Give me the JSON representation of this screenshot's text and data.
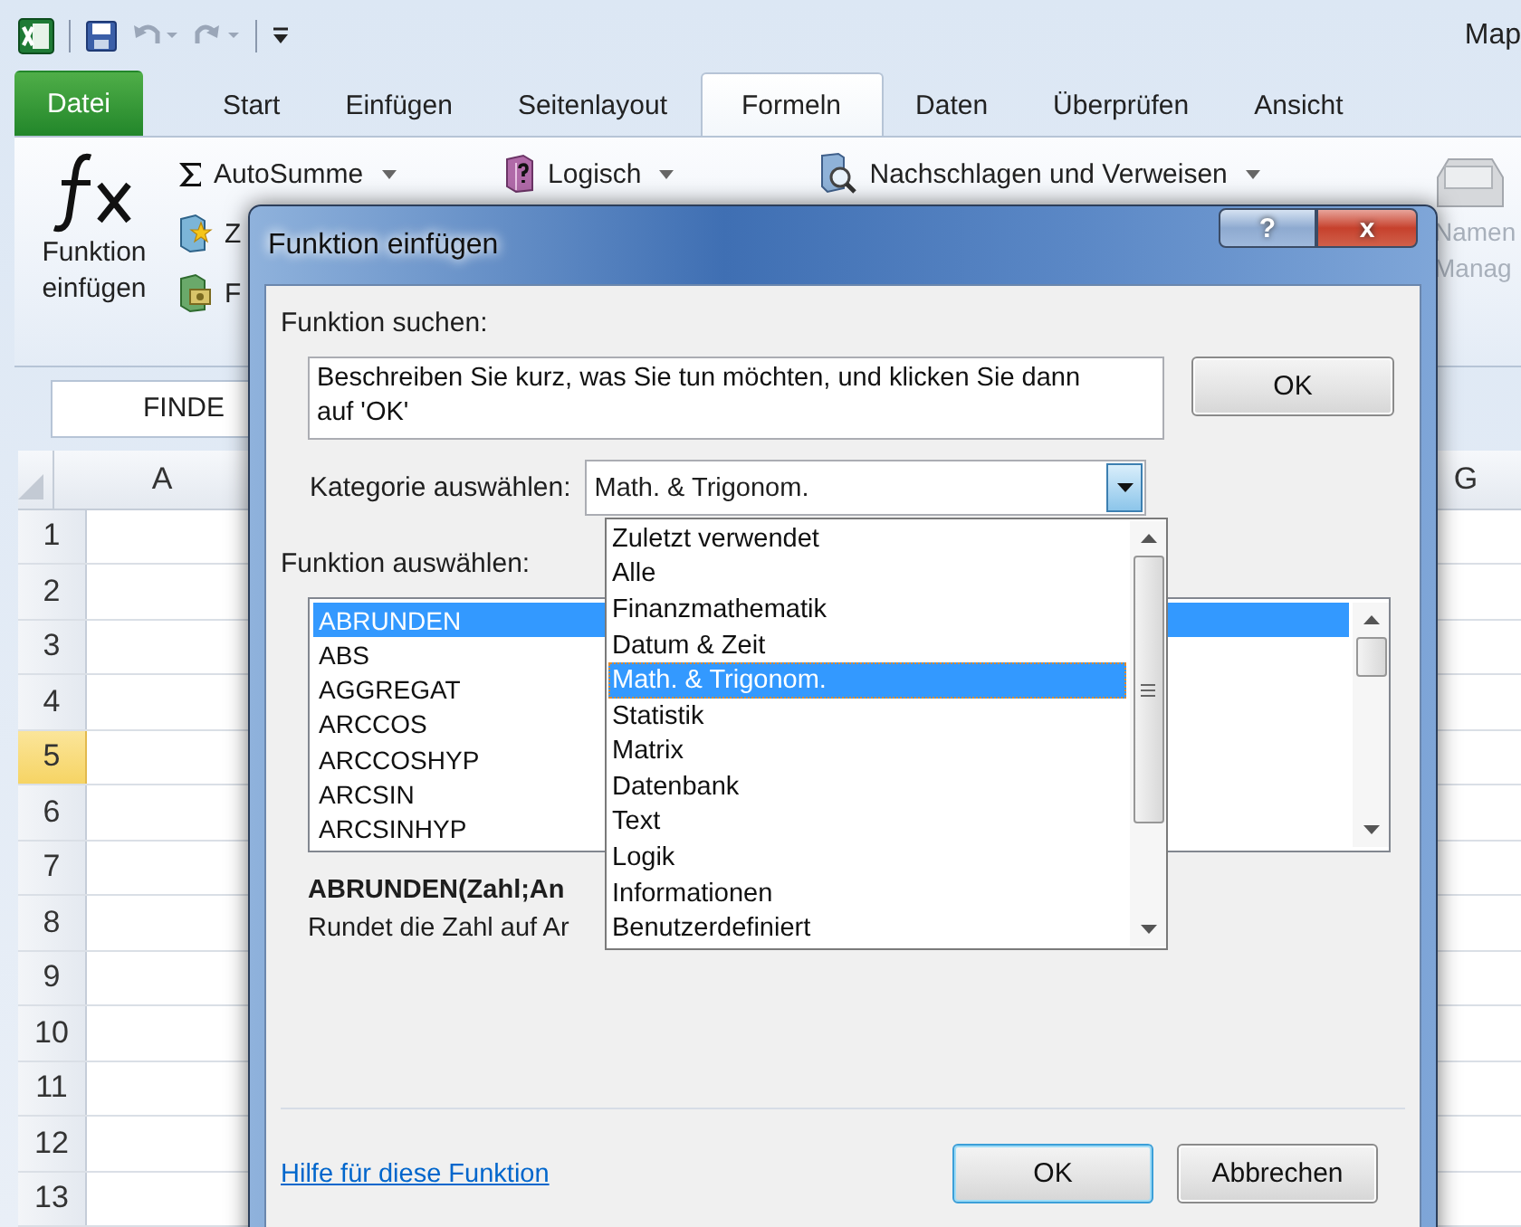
{
  "title_bar": {
    "title": "Map"
  },
  "ribbon_tabs": [
    {
      "label": "Datei",
      "kind": "file",
      "selected": false
    },
    {
      "label": "Start",
      "kind": "tab",
      "selected": false
    },
    {
      "label": "Einfügen",
      "kind": "tab",
      "selected": false
    },
    {
      "label": "Seitenlayout",
      "kind": "tab",
      "selected": false
    },
    {
      "label": "Formeln",
      "kind": "tab",
      "selected": true
    },
    {
      "label": "Daten",
      "kind": "tab",
      "selected": false
    },
    {
      "label": "Überprüfen",
      "kind": "tab",
      "selected": false
    },
    {
      "label": "Ansicht",
      "kind": "tab",
      "selected": false
    }
  ],
  "ribbon": {
    "insert_function": "Funktion einfügen",
    "commands": [
      {
        "label": "AutoSumme",
        "kind": "sum"
      },
      {
        "label": "Logisch",
        "kind": "logic"
      },
      {
        "label": "Nachschlagen und Verweisen",
        "kind": "lookup"
      }
    ],
    "partial_commands": [
      {
        "label": "Z",
        "kind": "recent"
      },
      {
        "label": "F",
        "kind": "finance"
      }
    ],
    "name_manager": [
      "Namen",
      "Manag"
    ]
  },
  "name_box": "FINDE",
  "columns": [
    "A",
    "G"
  ],
  "rows": [
    {
      "label": "1",
      "selected": false
    },
    {
      "label": "2",
      "selected": false
    },
    {
      "label": "3",
      "selected": false
    },
    {
      "label": "4",
      "selected": false
    },
    {
      "label": "5",
      "selected": true
    },
    {
      "label": "6",
      "selected": false
    },
    {
      "label": "7",
      "selected": false
    },
    {
      "label": "8",
      "selected": false
    },
    {
      "label": "9",
      "selected": false
    },
    {
      "label": "10",
      "selected": false
    },
    {
      "label": "11",
      "selected": false
    },
    {
      "label": "12",
      "selected": false
    },
    {
      "label": "13",
      "selected": false
    }
  ],
  "dialog": {
    "title": "Funktion einfügen",
    "help": "?",
    "close": "x",
    "search_label": "Funktion suchen:",
    "search_value": "Beschreiben Sie kurz, was Sie tun möchten, und klicken Sie dann auf 'OK'",
    "search_button": "OK",
    "category_label": "Kategorie auswählen:",
    "category_value": "Math. & Trigonom.",
    "category_options": [
      {
        "label": "Zuletzt verwendet",
        "selected": false
      },
      {
        "label": "Alle",
        "selected": false
      },
      {
        "label": "Finanzmathematik",
        "selected": false
      },
      {
        "label": "Datum & Zeit",
        "selected": false
      },
      {
        "label": "Math. & Trigonom.",
        "selected": true
      },
      {
        "label": "Statistik",
        "selected": false
      },
      {
        "label": "Matrix",
        "selected": false
      },
      {
        "label": "Datenbank",
        "selected": false
      },
      {
        "label": "Text",
        "selected": false
      },
      {
        "label": "Logik",
        "selected": false
      },
      {
        "label": "Informationen",
        "selected": false
      },
      {
        "label": "Benutzerdefiniert",
        "selected": false
      }
    ],
    "function_label": "Funktion auswählen:",
    "functions": [
      {
        "label": "ABRUNDEN",
        "selected": true
      },
      {
        "label": "ABS",
        "selected": false
      },
      {
        "label": "AGGREGAT",
        "selected": false
      },
      {
        "label": "ARCCOS",
        "selected": false
      },
      {
        "label": "ARCCOSHYP",
        "selected": false
      },
      {
        "label": "ARCSIN",
        "selected": false
      },
      {
        "label": "ARCSINHYP",
        "selected": false
      }
    ],
    "signature": "ABRUNDEN(Zahl;An",
    "description": "Rundet die Zahl auf Ar",
    "help_link": "Hilfe für diese Funktion",
    "buttons": [
      {
        "label": "OK",
        "default": true
      },
      {
        "label": "Abbrechen",
        "default": false
      }
    ]
  }
}
